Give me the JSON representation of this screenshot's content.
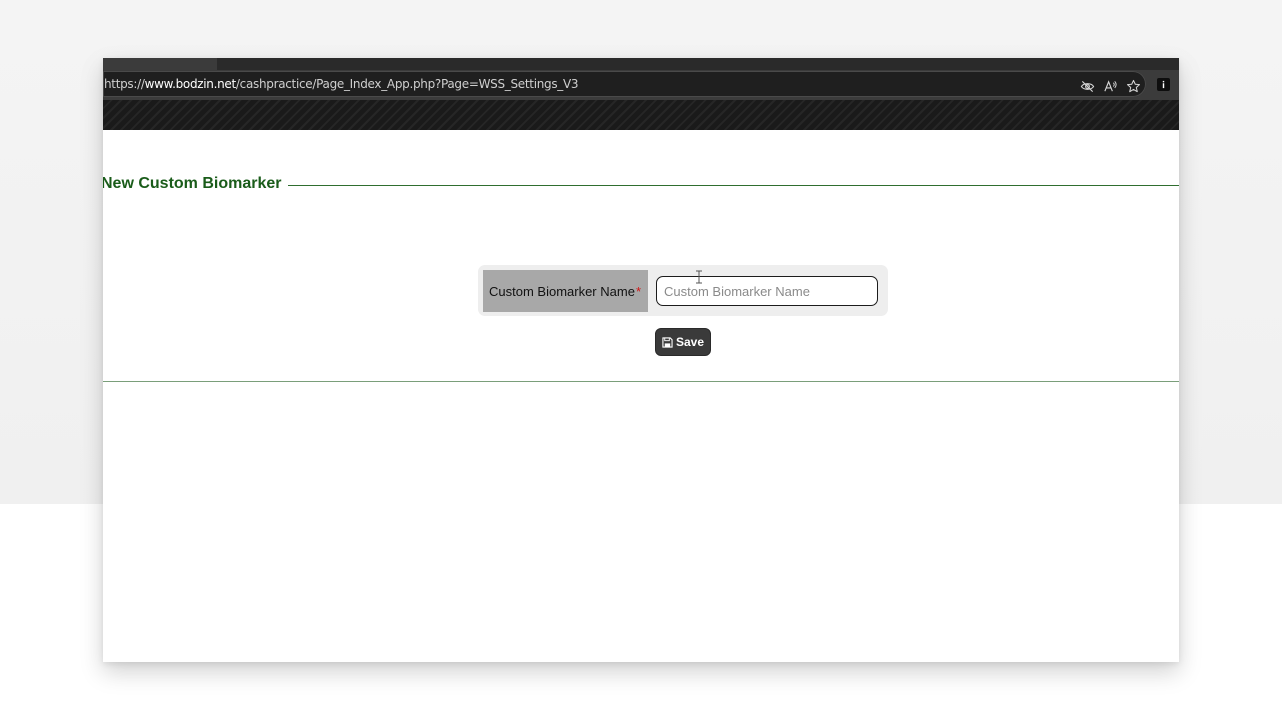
{
  "browser": {
    "url_prefix": "https://",
    "url_host": "www.bodzin.net",
    "url_path": "/cashpractice/Page_Index_App.php?Page=WSS_Settings_V3",
    "icons": [
      "tracking-prevention-icon",
      "read-aloud-icon",
      "favorite-star-icon",
      "info-icon"
    ]
  },
  "form": {
    "legend": "New Custom Biomarker",
    "field_label": "Custom Biomarker Name",
    "required_marker": "*",
    "input_placeholder": "Custom Biomarker Name",
    "input_value": "",
    "save_label": "Save"
  },
  "colors": {
    "legend": "#1a5c1a",
    "required": "#d01818",
    "save_button": "#3a3a3a",
    "label_cell": "#a8a8a8"
  }
}
